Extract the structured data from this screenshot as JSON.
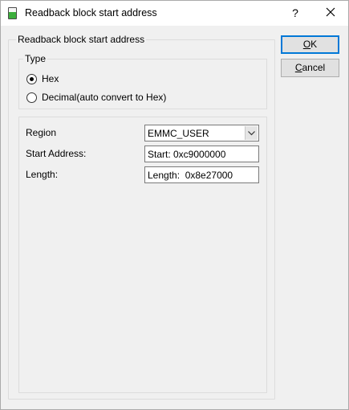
{
  "window": {
    "title": "Readback block start address",
    "help_label": "?"
  },
  "outer_group": {
    "legend": "Readback block start address"
  },
  "type_group": {
    "legend": "Type",
    "options": [
      {
        "label": "Hex",
        "checked": true
      },
      {
        "label": "Decimal(auto convert to Hex)",
        "checked": false
      }
    ]
  },
  "form": {
    "region_label": "Region",
    "region_value": "EMMC_USER",
    "start_label": "Start Address:",
    "start_value": "Start: 0xc9000000",
    "length_label": "Length:",
    "length_value": "Length:  0x8e27000"
  },
  "buttons": {
    "ok_mnemonic": "O",
    "ok_rest": "K",
    "cancel_mnemonic": "C",
    "cancel_rest": "ancel"
  },
  "colors": {
    "accent": "#0078d7",
    "dialog_bg": "#f0f0f0",
    "icon_green": "#3cae3c"
  },
  "icons": {
    "app": "app-icon",
    "close": "close-icon",
    "combo": "chevron-down-icon"
  }
}
